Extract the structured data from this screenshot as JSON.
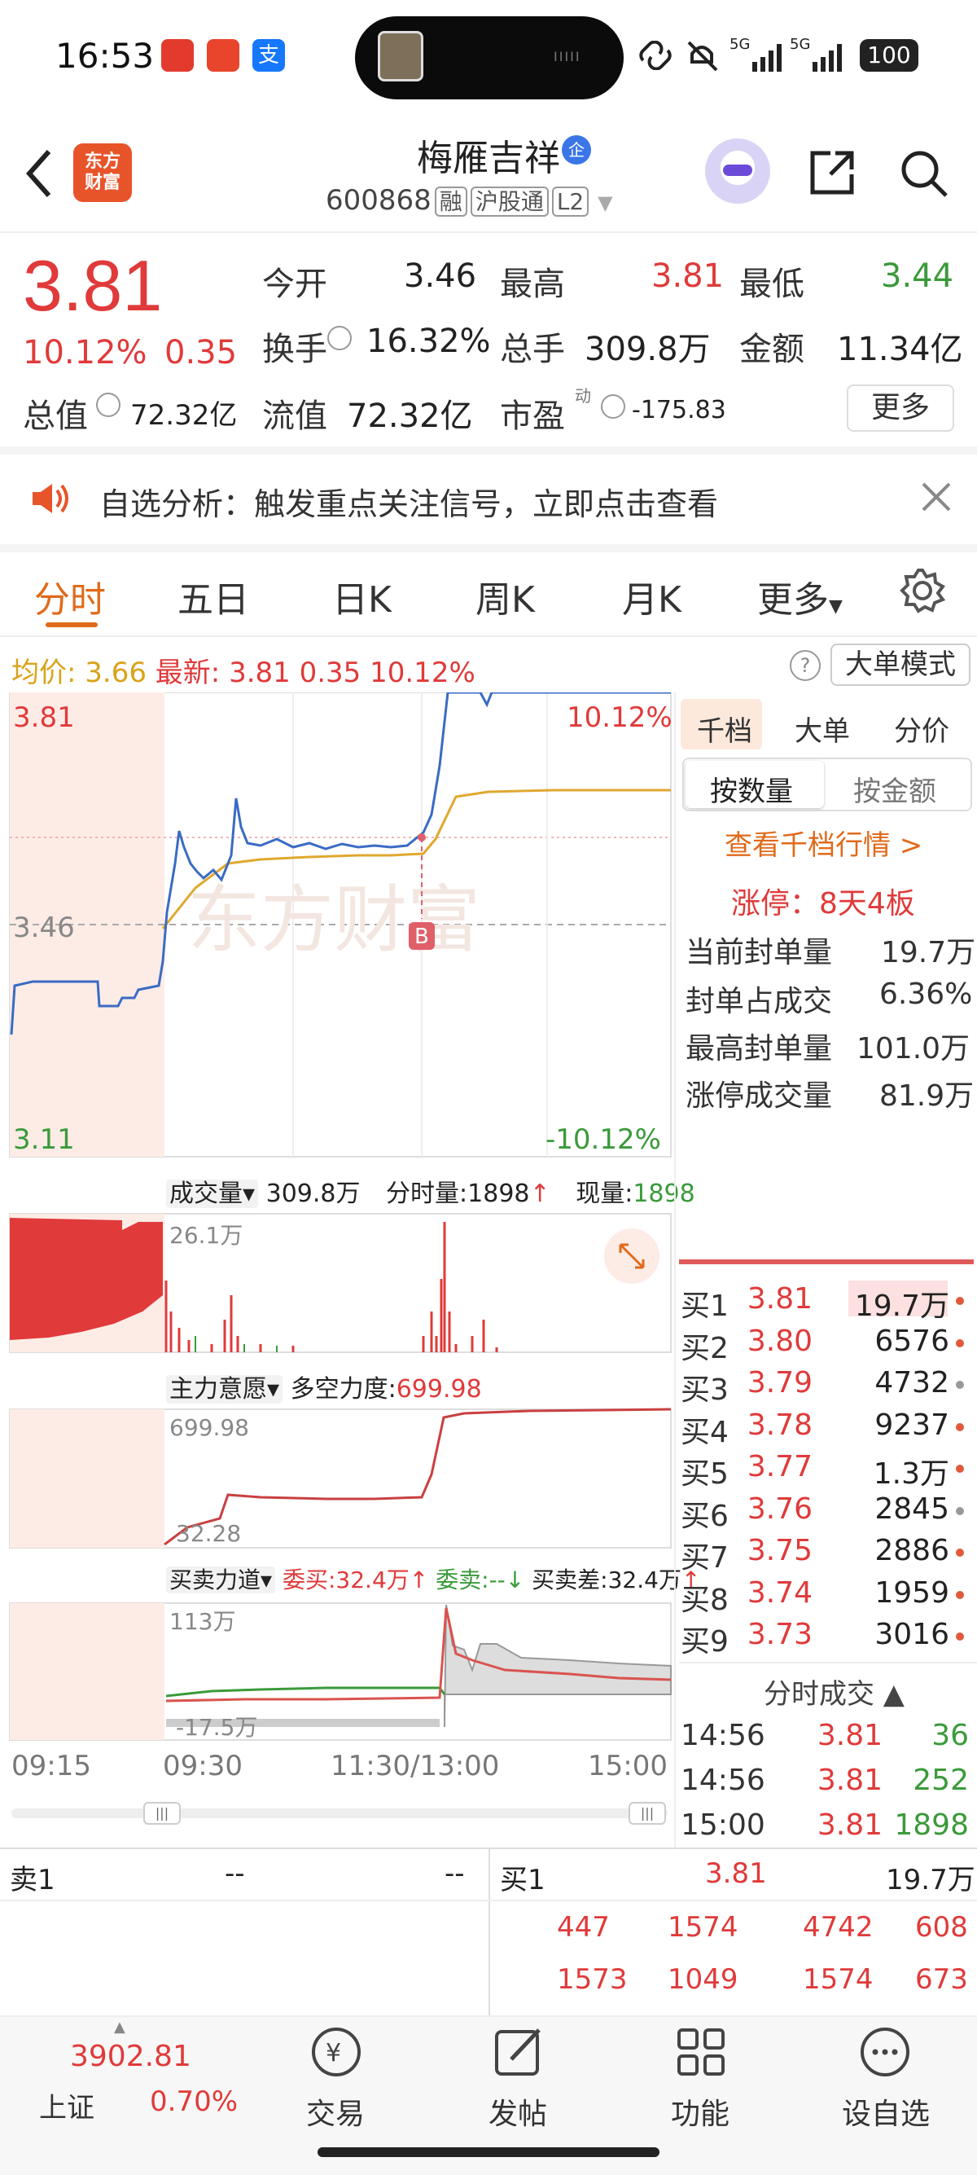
{
  "status": {
    "time": "16:53",
    "battery": "100",
    "net1": "5G",
    "net2": "5G"
  },
  "header": {
    "logo": "东方\n财富",
    "title": "梅雁吉祥",
    "badge": "企",
    "code": "600868",
    "tags": [
      "融",
      "沪股通",
      "L2"
    ]
  },
  "quote": {
    "price": "3.81",
    "pct": "10.12%",
    "change": "0.35",
    "open_lbl": "今开",
    "open": "3.46",
    "high_lbl": "最高",
    "high": "3.81",
    "low_lbl": "最低",
    "low": "3.44",
    "turnover_lbl": "换手",
    "turnover": "16.32%",
    "vol_lbl": "总手",
    "vol": "309.8万",
    "amount_lbl": "金额",
    "amount": "11.34亿",
    "mcap_lbl": "总值",
    "mcap": "72.32亿",
    "float_lbl": "流值",
    "float": "72.32亿",
    "pe_lbl": "市盈",
    "pe_sup": "动",
    "pe": "-175.83",
    "more": "更多"
  },
  "notice": {
    "text": "自选分析：触发重点关注信号，立即点击查看"
  },
  "tabs": [
    "分时",
    "五日",
    "日K",
    "周K",
    "月K",
    "更多"
  ],
  "infoline": {
    "avg_lbl": "均价:",
    "avg": "3.66",
    "last_lbl": "最新:",
    "last": "3.81",
    "chg": "0.35",
    "pct": "10.12%",
    "help": "?",
    "mode": "大单模式"
  },
  "chart": {
    "ytop": "3.81",
    "ymid": "3.46",
    "ybot": "3.11",
    "pct_top": "10.12%",
    "pct_bot": "-10.12%",
    "watermark": "东方财富",
    "marker": "B",
    "times": [
      "09:15",
      "09:30",
      "11:30/13:00",
      "15:00"
    ]
  },
  "volume": {
    "sel": "成交量",
    "total": "309.8万",
    "fen_lbl": "分时量:1898",
    "now_lbl": "现量:",
    "now": "1898",
    "max": "26.1万"
  },
  "main_force": {
    "sel": "主力意愿",
    "lbl": "多空力度:",
    "val": "699.98",
    "top": "699.98",
    "bot": "32.28"
  },
  "buysell": {
    "sel": "买卖力道",
    "buy": "委买:32.4万",
    "sell": "委卖:--",
    "diff": "买卖差:32.4万",
    "top": "113万",
    "bot": "-17.5万"
  },
  "side": {
    "tabs": [
      "千档",
      "大单",
      "分价"
    ],
    "seg": [
      "按数量",
      "按金额"
    ],
    "link": "查看千档行情 >",
    "limit": "涨停：8天4板",
    "stats": [
      {
        "label": "当前封单量",
        "value": "19.7万"
      },
      {
        "label": "封单占成交",
        "value": "6.36%"
      },
      {
        "label": "最高封单量",
        "value": "101.0万"
      },
      {
        "label": "涨停成交量",
        "value": "81.9万"
      }
    ],
    "book": [
      {
        "label": "买1",
        "price": "3.81",
        "vol": "19.7万"
      },
      {
        "label": "买2",
        "price": "3.80",
        "vol": "6576"
      },
      {
        "label": "买3",
        "price": "3.79",
        "vol": "4732"
      },
      {
        "label": "买4",
        "price": "3.78",
        "vol": "9237"
      },
      {
        "label": "买5",
        "price": "3.77",
        "vol": "1.3万"
      },
      {
        "label": "买6",
        "price": "3.76",
        "vol": "2845"
      },
      {
        "label": "买7",
        "price": "3.75",
        "vol": "2886"
      },
      {
        "label": "买8",
        "price": "3.74",
        "vol": "1959"
      },
      {
        "label": "买9",
        "price": "3.73",
        "vol": "3016"
      }
    ],
    "trades_title": "分时成交",
    "trades": [
      {
        "time": "14:56",
        "price": "3.81",
        "vol": "36"
      },
      {
        "time": "14:56",
        "price": "3.81",
        "vol": "252"
      },
      {
        "time": "15:00",
        "price": "3.81",
        "vol": "1898"
      }
    ]
  },
  "queue": {
    "sell1": "卖1",
    "sell_px": "--",
    "sell_vol": "--",
    "buy1": "买1",
    "buy_px": "3.81",
    "buy_vol": "19.7万",
    "row1": [
      "447",
      "1574",
      "4742",
      "608"
    ],
    "row2": [
      "1573",
      "1049",
      "1574",
      "673"
    ]
  },
  "bottom": {
    "index_val": "3902.81",
    "index_name": "上证",
    "index_pct": "0.70%",
    "nav": [
      "交易",
      "发帖",
      "功能",
      "设自选"
    ]
  }
}
